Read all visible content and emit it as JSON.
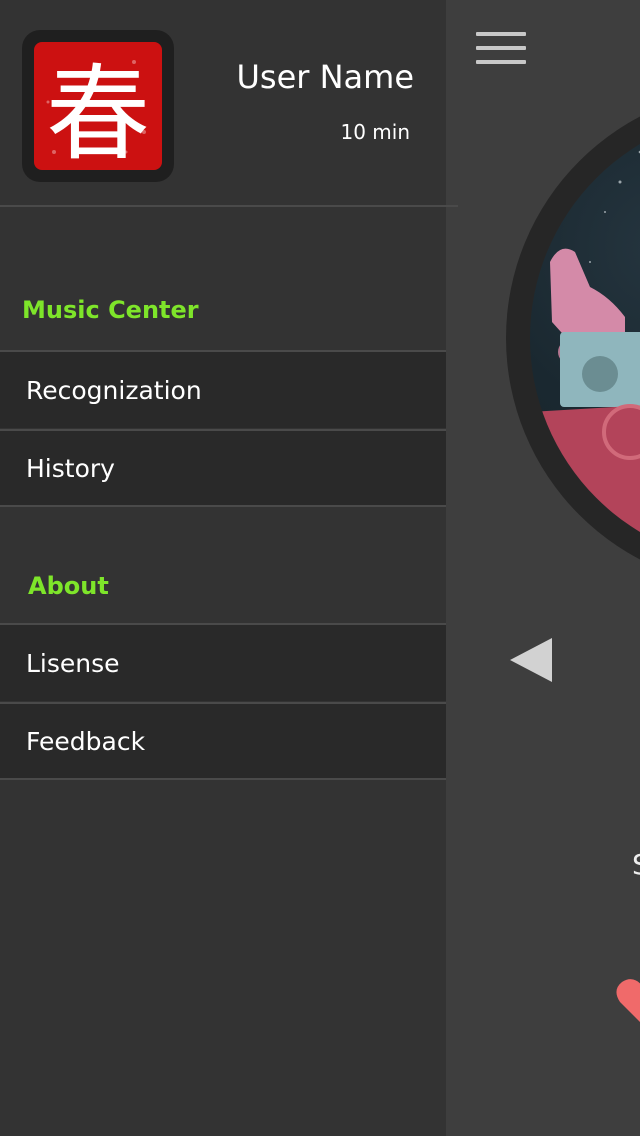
{
  "profile": {
    "user_name": "User Name",
    "time": "10 min",
    "avatar_char": "春",
    "avatar_color": "#cc1111"
  },
  "sections": [
    {
      "title": "Music Center",
      "items": [
        {
          "label": "Recognization"
        },
        {
          "label": "History"
        }
      ]
    },
    {
      "title": "About",
      "items": [
        {
          "label": "Lisense"
        },
        {
          "label": "Feedback"
        }
      ]
    }
  ],
  "player": {
    "partial_title": "S",
    "icons": [
      "menu-icon",
      "prev-arrow-icon",
      "heart-icon"
    ]
  },
  "colors": {
    "accent": "#7ee52a",
    "drawer_bg": "#333333",
    "row_bg": "#292929",
    "heart": "#f06a6a"
  }
}
